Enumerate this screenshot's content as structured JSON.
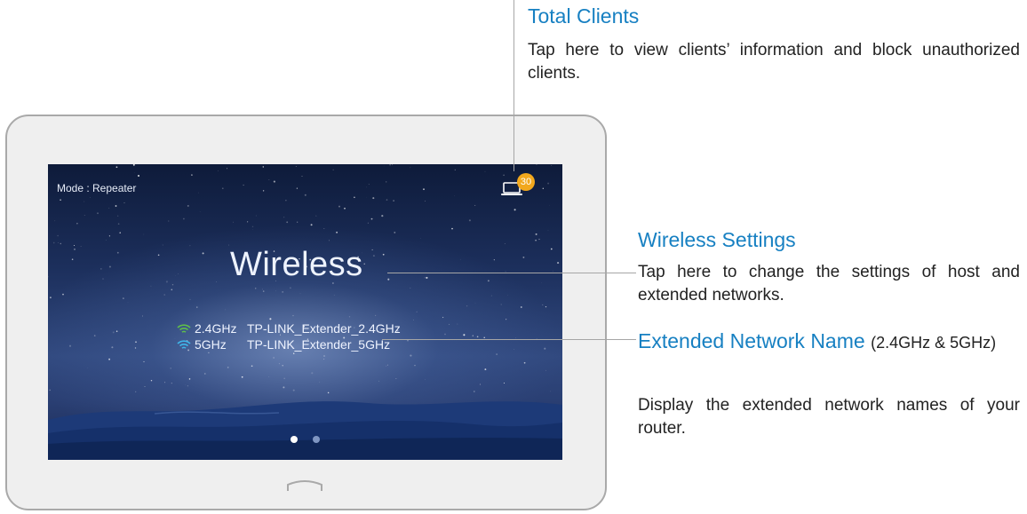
{
  "device": {
    "mode_text": "Mode : Repeater",
    "client_count": "30",
    "page_title": "Wireless",
    "networks": [
      {
        "band": "2.4GHz",
        "ssid": "TP-LINK_Extender_2.4GHz",
        "icon": "wifi-icon",
        "color": "#5fbf4a"
      },
      {
        "band": "5GHz",
        "ssid": "TP-LINK_Extender_5GHz",
        "icon": "wifi-icon",
        "color": "#3fb6ea"
      }
    ],
    "page_indicator": {
      "total": 2,
      "active": 1
    }
  },
  "annotations": {
    "total_clients": {
      "title": "Total Clients",
      "body": "Tap here to view clients’ information and block unauthorized clients."
    },
    "wireless_settings": {
      "title": "Wireless Settings",
      "body": "Tap here to change the settings of host and extended networks."
    },
    "extended_network": {
      "title": "Extended Network Name",
      "title_suffix": "(2.4GHz & 5GHz)",
      "body": "Display the extended network names of your router."
    }
  },
  "colors": {
    "accent": "#1780c2",
    "badge": "#f2a81d",
    "wifi_24": "#5fbf4a",
    "wifi_5": "#3fb6ea"
  }
}
